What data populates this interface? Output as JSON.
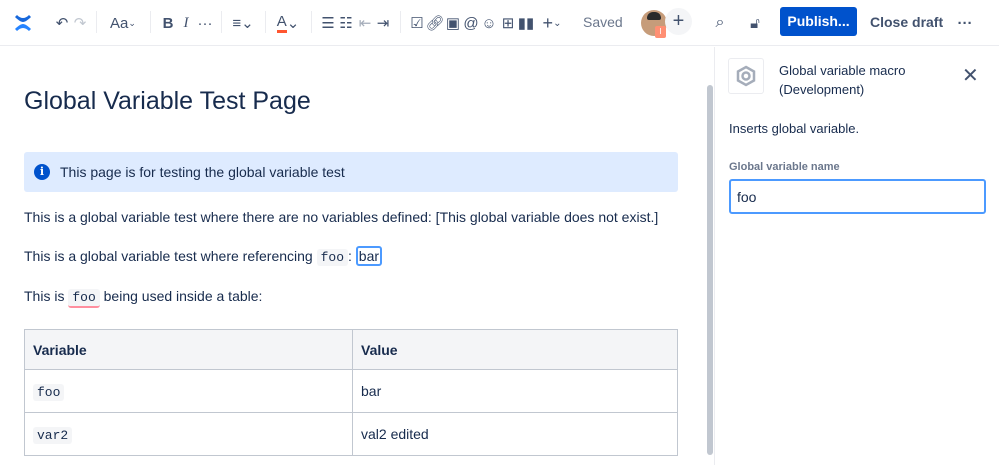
{
  "toolbar": {
    "text_style": "Aa",
    "bold": "B",
    "italic": "I",
    "saved": "Saved",
    "publish": "Publish...",
    "close_draft": "Close draft",
    "avatar_badge": "I"
  },
  "page": {
    "title": "Global Variable Test Page",
    "info_panel": "This page is for testing the global variable test",
    "para1": "This is a global variable test where there are no variables defined: [This global variable does not exist.]",
    "para2_prefix": "This is a global variable test where referencing ",
    "para2_code": "foo",
    "para2_sep": ": ",
    "para2_value": "bar",
    "para3_prefix": "This is ",
    "para3_code": "foo",
    "para3_suffix": " being used inside a table:",
    "table": {
      "headers": [
        "Variable",
        "Value"
      ],
      "rows": [
        [
          "foo",
          "bar"
        ],
        [
          "var2",
          "val2 edited"
        ]
      ]
    }
  },
  "panel": {
    "title_line1": "Global variable macro",
    "title_line2": "(Development)",
    "description": "Inserts global variable.",
    "field_label": "Global variable name",
    "field_value": "foo"
  }
}
